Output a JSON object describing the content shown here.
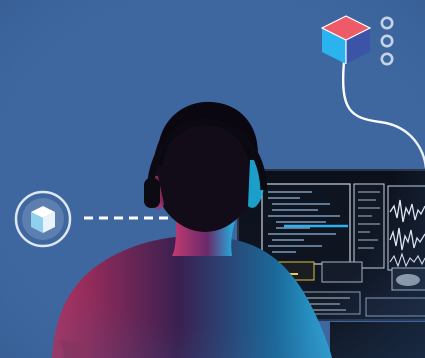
{
  "scene": {
    "background_color": "#3e67a0",
    "subject": "person-seen-from-behind-wearing-headset",
    "monitor": "dark-monitor-with-code-and-waveforms",
    "accent_colors": [
      "#e23c6e",
      "#1fb8e8",
      "#d9e7f4"
    ]
  },
  "icons": {
    "cube_left": "cube-icon",
    "cube_right": "cube-icon",
    "menu": "vertical-dots-icon"
  }
}
